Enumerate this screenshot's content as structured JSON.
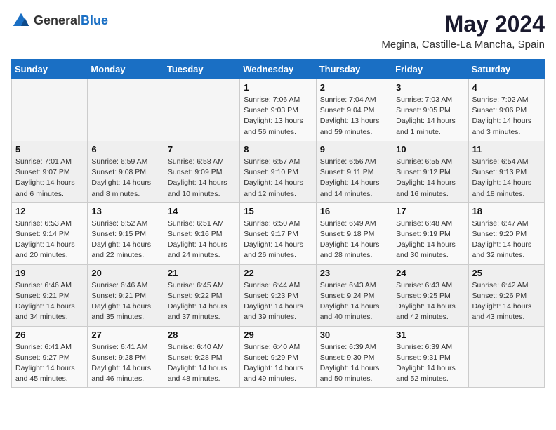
{
  "header": {
    "logo_general": "General",
    "logo_blue": "Blue",
    "title": "May 2024",
    "subtitle": "Megina, Castille-La Mancha, Spain"
  },
  "weekdays": [
    "Sunday",
    "Monday",
    "Tuesday",
    "Wednesday",
    "Thursday",
    "Friday",
    "Saturday"
  ],
  "weeks": [
    [
      {
        "day": "",
        "info": ""
      },
      {
        "day": "",
        "info": ""
      },
      {
        "day": "",
        "info": ""
      },
      {
        "day": "1",
        "info": "Sunrise: 7:06 AM\nSunset: 9:03 PM\nDaylight: 13 hours\nand 56 minutes."
      },
      {
        "day": "2",
        "info": "Sunrise: 7:04 AM\nSunset: 9:04 PM\nDaylight: 13 hours\nand 59 minutes."
      },
      {
        "day": "3",
        "info": "Sunrise: 7:03 AM\nSunset: 9:05 PM\nDaylight: 14 hours\nand 1 minute."
      },
      {
        "day": "4",
        "info": "Sunrise: 7:02 AM\nSunset: 9:06 PM\nDaylight: 14 hours\nand 3 minutes."
      }
    ],
    [
      {
        "day": "5",
        "info": "Sunrise: 7:01 AM\nSunset: 9:07 PM\nDaylight: 14 hours\nand 6 minutes."
      },
      {
        "day": "6",
        "info": "Sunrise: 6:59 AM\nSunset: 9:08 PM\nDaylight: 14 hours\nand 8 minutes."
      },
      {
        "day": "7",
        "info": "Sunrise: 6:58 AM\nSunset: 9:09 PM\nDaylight: 14 hours\nand 10 minutes."
      },
      {
        "day": "8",
        "info": "Sunrise: 6:57 AM\nSunset: 9:10 PM\nDaylight: 14 hours\nand 12 minutes."
      },
      {
        "day": "9",
        "info": "Sunrise: 6:56 AM\nSunset: 9:11 PM\nDaylight: 14 hours\nand 14 minutes."
      },
      {
        "day": "10",
        "info": "Sunrise: 6:55 AM\nSunset: 9:12 PM\nDaylight: 14 hours\nand 16 minutes."
      },
      {
        "day": "11",
        "info": "Sunrise: 6:54 AM\nSunset: 9:13 PM\nDaylight: 14 hours\nand 18 minutes."
      }
    ],
    [
      {
        "day": "12",
        "info": "Sunrise: 6:53 AM\nSunset: 9:14 PM\nDaylight: 14 hours\nand 20 minutes."
      },
      {
        "day": "13",
        "info": "Sunrise: 6:52 AM\nSunset: 9:15 PM\nDaylight: 14 hours\nand 22 minutes."
      },
      {
        "day": "14",
        "info": "Sunrise: 6:51 AM\nSunset: 9:16 PM\nDaylight: 14 hours\nand 24 minutes."
      },
      {
        "day": "15",
        "info": "Sunrise: 6:50 AM\nSunset: 9:17 PM\nDaylight: 14 hours\nand 26 minutes."
      },
      {
        "day": "16",
        "info": "Sunrise: 6:49 AM\nSunset: 9:18 PM\nDaylight: 14 hours\nand 28 minutes."
      },
      {
        "day": "17",
        "info": "Sunrise: 6:48 AM\nSunset: 9:19 PM\nDaylight: 14 hours\nand 30 minutes."
      },
      {
        "day": "18",
        "info": "Sunrise: 6:47 AM\nSunset: 9:20 PM\nDaylight: 14 hours\nand 32 minutes."
      }
    ],
    [
      {
        "day": "19",
        "info": "Sunrise: 6:46 AM\nSunset: 9:21 PM\nDaylight: 14 hours\nand 34 minutes."
      },
      {
        "day": "20",
        "info": "Sunrise: 6:46 AM\nSunset: 9:21 PM\nDaylight: 14 hours\nand 35 minutes."
      },
      {
        "day": "21",
        "info": "Sunrise: 6:45 AM\nSunset: 9:22 PM\nDaylight: 14 hours\nand 37 minutes."
      },
      {
        "day": "22",
        "info": "Sunrise: 6:44 AM\nSunset: 9:23 PM\nDaylight: 14 hours\nand 39 minutes."
      },
      {
        "day": "23",
        "info": "Sunrise: 6:43 AM\nSunset: 9:24 PM\nDaylight: 14 hours\nand 40 minutes."
      },
      {
        "day": "24",
        "info": "Sunrise: 6:43 AM\nSunset: 9:25 PM\nDaylight: 14 hours\nand 42 minutes."
      },
      {
        "day": "25",
        "info": "Sunrise: 6:42 AM\nSunset: 9:26 PM\nDaylight: 14 hours\nand 43 minutes."
      }
    ],
    [
      {
        "day": "26",
        "info": "Sunrise: 6:41 AM\nSunset: 9:27 PM\nDaylight: 14 hours\nand 45 minutes."
      },
      {
        "day": "27",
        "info": "Sunrise: 6:41 AM\nSunset: 9:28 PM\nDaylight: 14 hours\nand 46 minutes."
      },
      {
        "day": "28",
        "info": "Sunrise: 6:40 AM\nSunset: 9:28 PM\nDaylight: 14 hours\nand 48 minutes."
      },
      {
        "day": "29",
        "info": "Sunrise: 6:40 AM\nSunset: 9:29 PM\nDaylight: 14 hours\nand 49 minutes."
      },
      {
        "day": "30",
        "info": "Sunrise: 6:39 AM\nSunset: 9:30 PM\nDaylight: 14 hours\nand 50 minutes."
      },
      {
        "day": "31",
        "info": "Sunrise: 6:39 AM\nSunset: 9:31 PM\nDaylight: 14 hours\nand 52 minutes."
      },
      {
        "day": "",
        "info": ""
      }
    ]
  ]
}
